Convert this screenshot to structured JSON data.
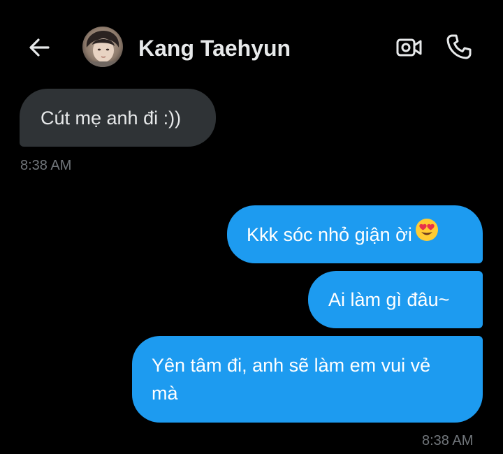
{
  "header": {
    "contact_name": "Kang Taehyun",
    "back_icon": "arrow-left-icon",
    "video_icon": "video-camera-icon",
    "call_icon": "phone-icon"
  },
  "messages": [
    {
      "direction": "received",
      "text": "Cút mẹ anh đi :))",
      "time": "8:38 AM"
    },
    {
      "direction": "sent",
      "text": "Kkk sóc nhỏ giận ời",
      "emoji": "smiling-face-with-heart-eyes"
    },
    {
      "direction": "sent",
      "text": "Ai làm gì đâu~"
    },
    {
      "direction": "sent",
      "line1": "Yên tâm đi, anh sẽ làm em vui vẻ",
      "line2": "mà",
      "time": "8:38 AM"
    }
  ],
  "colors": {
    "background": "#000000",
    "received_bubble": "#2f3336",
    "sent_bubble": "#1d9bf0",
    "timestamp": "#71767b"
  }
}
